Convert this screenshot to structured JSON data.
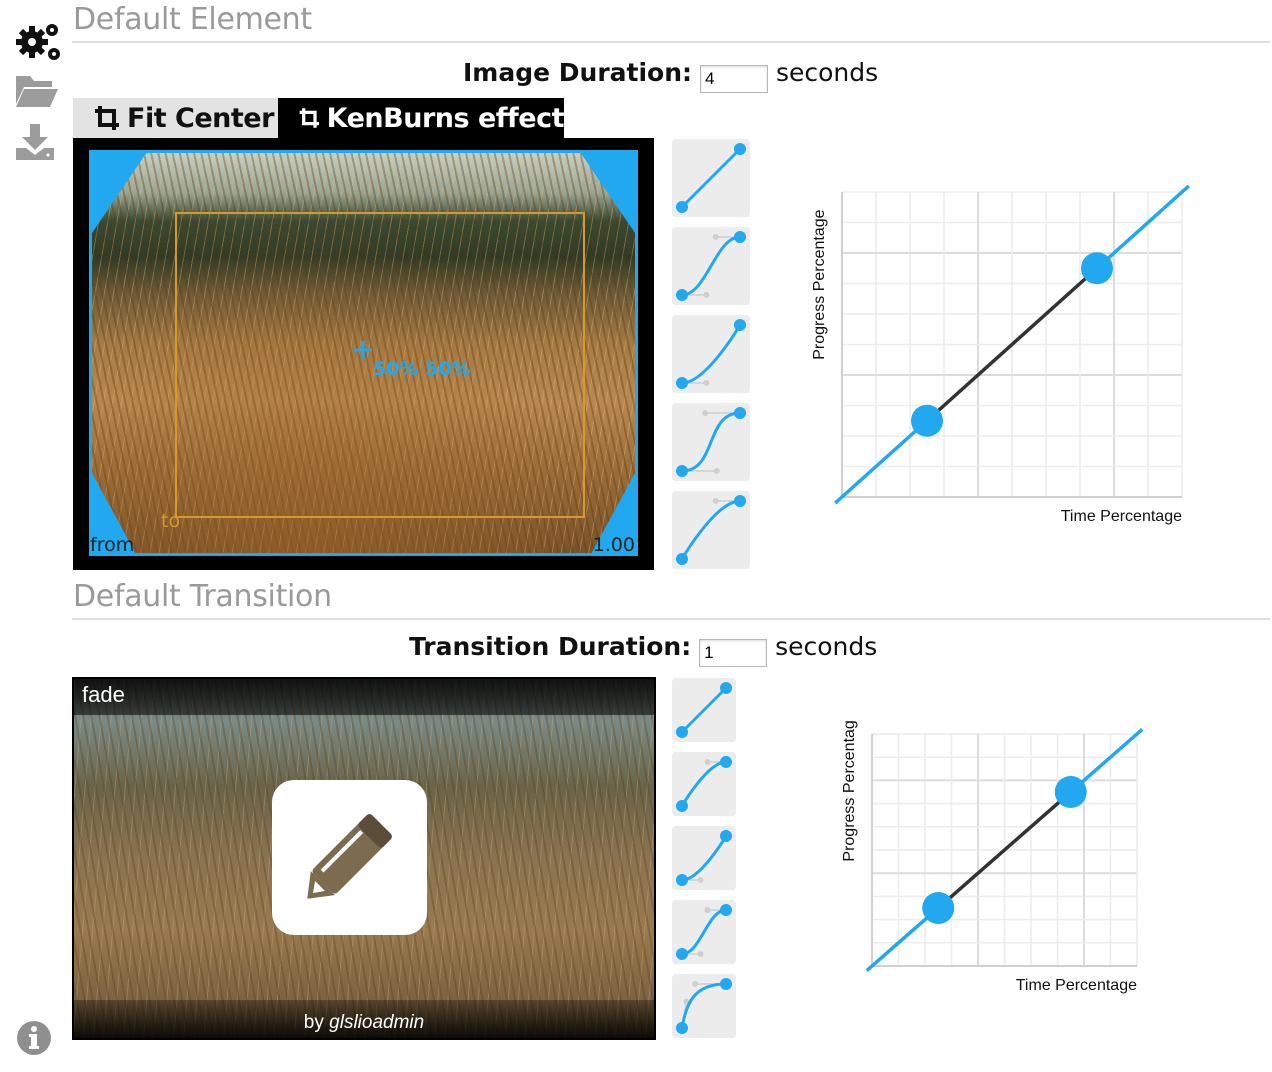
{
  "sidebar": {
    "items": [
      {
        "name": "settings",
        "icon": "gears-icon"
      },
      {
        "name": "open",
        "icon": "folder-open-icon"
      },
      {
        "name": "download",
        "icon": "download-icon"
      },
      {
        "name": "info",
        "icon": "info-icon"
      }
    ]
  },
  "element_section": {
    "title": "Default Element",
    "duration_label": "Image Duration:",
    "duration_value": "4",
    "duration_unit": "seconds",
    "tabs": [
      {
        "label": "Fit Center",
        "active": false,
        "icon": "crop-icon"
      },
      {
        "label": "KenBurns effect",
        "active": true,
        "icon": "crop-icon"
      }
    ],
    "kenburns": {
      "center_label": "50% 50%",
      "from_label": "from",
      "to_label": "to",
      "zoom_label": "1.00"
    },
    "easings": [
      "linear",
      "ease-in-out",
      "ease-in",
      "ease-in-out-strong",
      "ease-out"
    ],
    "chart": {
      "xlabel": "Time Percentage",
      "ylabel": "Progress Percentage",
      "accent": "#21a8ef"
    }
  },
  "transition_section": {
    "title": "Default Transition",
    "duration_label": "Transition Duration:",
    "duration_value": "1",
    "duration_unit": "seconds",
    "transition_name": "fade",
    "author_prefix": "by ",
    "author": "glslioadmin",
    "edit_icon": "pencil-icon",
    "easings": [
      "linear",
      "ease-out",
      "ease-in",
      "ease-in-out",
      "ease-out-strong"
    ],
    "chart": {
      "xlabel": "Time Percentage",
      "ylabel": "Progress Percentage",
      "accent": "#21a8ef"
    }
  }
}
